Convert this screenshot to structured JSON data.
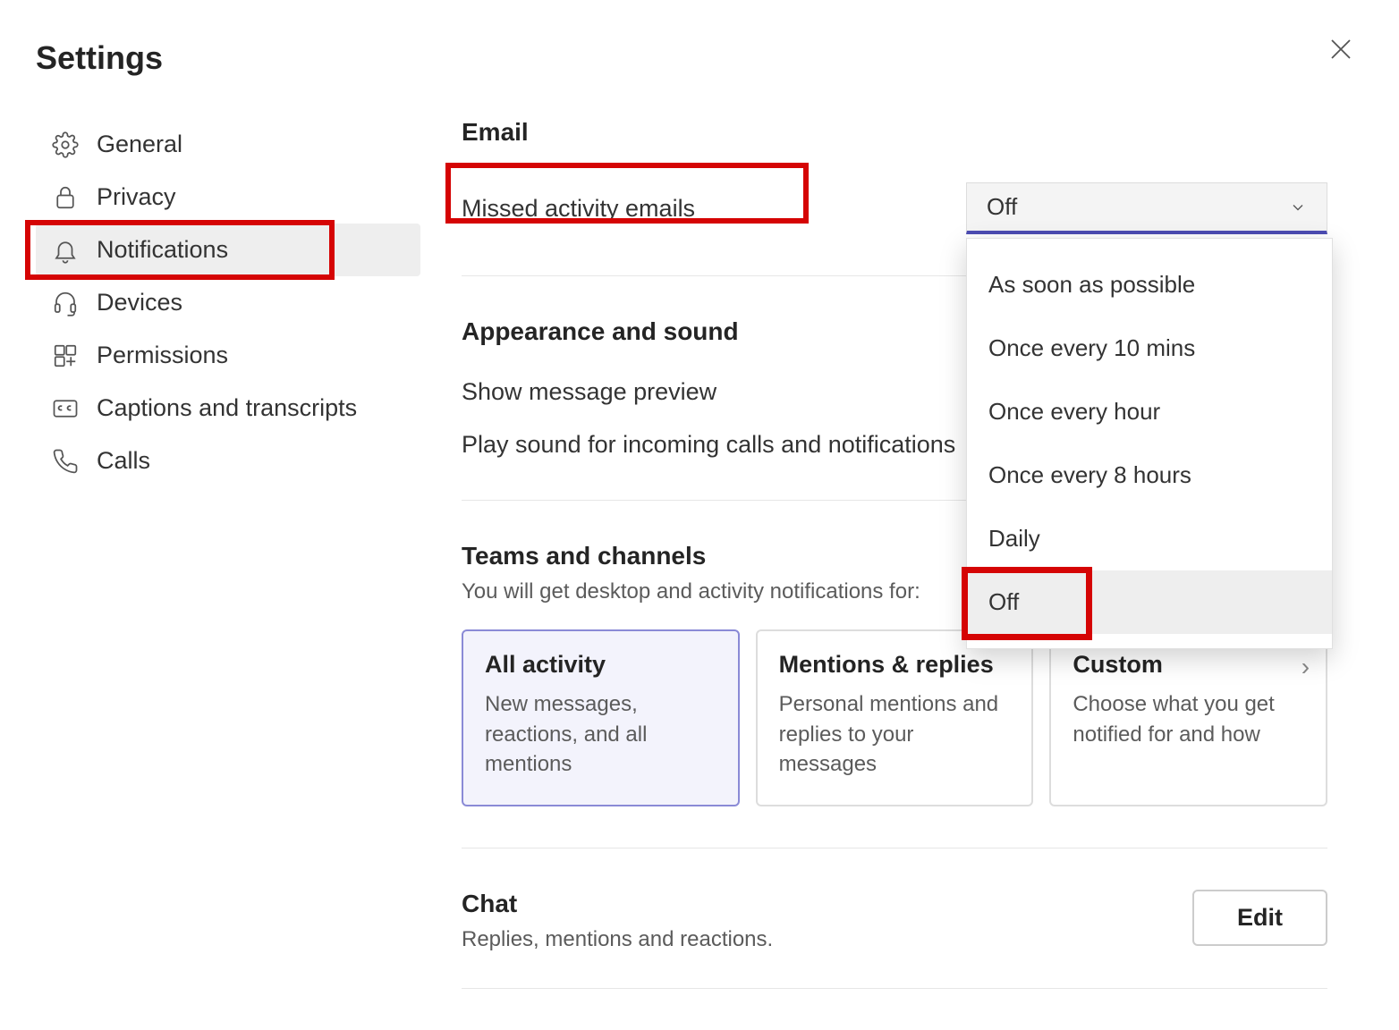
{
  "title": "Settings",
  "sidebar": {
    "items": [
      {
        "label": "General"
      },
      {
        "label": "Privacy"
      },
      {
        "label": "Notifications"
      },
      {
        "label": "Devices"
      },
      {
        "label": "Permissions"
      },
      {
        "label": "Captions and transcripts"
      },
      {
        "label": "Calls"
      }
    ]
  },
  "email_section": {
    "heading": "Email",
    "missed_label": "Missed activity emails",
    "selected_value": "Off",
    "options": [
      "As soon as possible",
      "Once every 10 mins",
      "Once every hour",
      "Once every 8 hours",
      "Daily",
      "Off"
    ]
  },
  "appearance_section": {
    "heading": "Appearance and sound",
    "preview_label": "Show message preview",
    "sound_label": "Play sound for incoming calls and notifications"
  },
  "teams_section": {
    "heading": "Teams and channels",
    "subtitle": "You will get desktop and activity notifications for:",
    "cards": [
      {
        "title": "All activity",
        "desc": "New messages, reactions, and all mentions"
      },
      {
        "title": "Mentions & replies",
        "desc": "Personal mentions and replies to your messages"
      },
      {
        "title": "Custom",
        "desc": "Choose what you get notified for and how"
      }
    ]
  },
  "chat_section": {
    "heading": "Chat",
    "subtitle": "Replies, mentions and reactions.",
    "edit_label": "Edit"
  }
}
